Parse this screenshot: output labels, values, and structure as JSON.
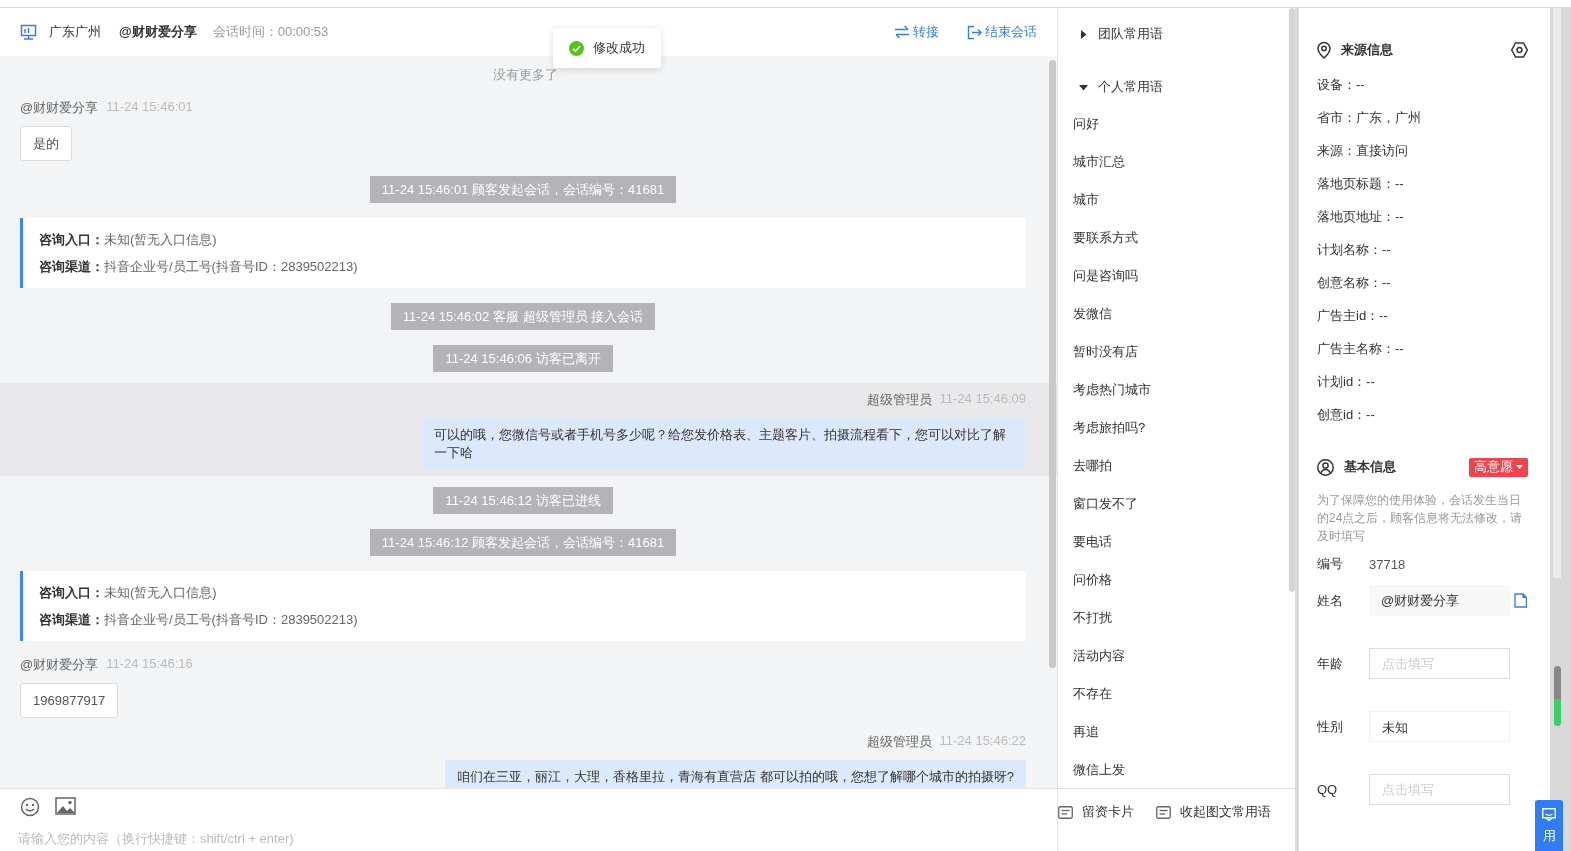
{
  "header": {
    "location": "广东广州",
    "visitor": "@财财爱分享",
    "duration_label": "会话时间：",
    "duration": "00:00:53",
    "actions": [
      {
        "kind": "transfer",
        "label": "转接"
      },
      {
        "kind": "end",
        "label": "结束会话"
      }
    ]
  },
  "toast": {
    "text": "修改成功"
  },
  "messages": [
    {
      "kind": "notice",
      "text": "没有更多了"
    },
    {
      "kind": "visitor",
      "name": "@财财爱分享",
      "time": "11-24 15:46:01",
      "text": "是的"
    },
    {
      "kind": "system",
      "text": "11-24 15:46:01 顾客发起会话，会话编号：41681"
    },
    {
      "kind": "info",
      "rows": [
        {
          "label": "咨询入口：",
          "value": "未知(暂无入口信息)"
        },
        {
          "label": "咨询渠道：",
          "value": "抖音企业号/员工号(抖音号ID：2839502213)"
        }
      ]
    },
    {
      "kind": "system",
      "text": "11-24 15:46:02 客服 超级管理员 接入会话"
    },
    {
      "kind": "system",
      "text": "11-24 15:46:06 访客已离开"
    },
    {
      "kind": "agent",
      "name": "超级管理员",
      "time": "11-24 15:46:09",
      "text": "可以的哦，您微信号或者手机号多少呢？给您发价格表、主题客片、拍摄流程看下，您可以对比了解一下哈",
      "highlighted": true
    },
    {
      "kind": "system",
      "text": "11-24 15:46:12 访客已进线"
    },
    {
      "kind": "system",
      "text": "11-24 15:46:12 顾客发起会话，会话编号：41681"
    },
    {
      "kind": "info",
      "rows": [
        {
          "label": "咨询入口：",
          "value": "未知(暂无入口信息)"
        },
        {
          "label": "咨询渠道：",
          "value": "抖音企业号/员工号(抖音号ID：2839502213)"
        }
      ]
    },
    {
      "kind": "visitor",
      "name": "@财财爱分享",
      "time": "11-24 15:46:16",
      "text": "1969877917"
    },
    {
      "kind": "agent",
      "name": "超级管理员",
      "time": "11-24 15:46:22",
      "text": "咱们在三亚，丽江，大理，香格里拉，青海有直营店 都可以拍的哦，您想了解哪个城市的拍摄呀?",
      "highlighted": false
    }
  ],
  "composer": {
    "placeholder": "请输入您的内容（换行快捷键：shift/ctrl + enter)"
  },
  "phrases": {
    "groups": [
      {
        "title": "团队常用语",
        "expanded": false
      },
      {
        "title": "个人常用语",
        "expanded": true,
        "items": [
          "问好",
          "城市汇总",
          "城市",
          "要联系方式",
          "问是咨询吗",
          "发微信",
          "暂时没有店",
          "考虑热门城市",
          "考虑旅拍吗?",
          "去哪拍",
          "窗口发不了",
          "要电话",
          "问价格",
          "不打扰",
          "活动内容",
          "不存在",
          "再追",
          "微信上发"
        ]
      }
    ],
    "footer": [
      "留资卡片",
      "收起图文常用语"
    ]
  },
  "source": {
    "title": "来源信息",
    "fields": [
      "设备：--",
      "省市：广东，广州",
      "来源：直接访问",
      "落地页标题：--",
      "落地页地址：--",
      "计划名称：--",
      "创意名称：--",
      "广告主id：--",
      "广告主名称：--",
      "计划id：--",
      "创意id：--"
    ]
  },
  "basic": {
    "title": "基本信息",
    "tag": "高意愿",
    "note": "为了保障您的使用体验，会话发生当日的24点之后，顾客信息将无法修改，请及时填写",
    "id_label": "编号",
    "id": "37718",
    "fields": [
      {
        "label": "姓名",
        "kind": "readonly",
        "value": "@财财爱分享",
        "copyable": true
      },
      {
        "label": "年龄",
        "kind": "input",
        "placeholder": "点击填写",
        "copyable": false
      },
      {
        "label": "性别",
        "kind": "select",
        "value": "未知",
        "copyable": false
      },
      {
        "label": "QQ",
        "kind": "input",
        "placeholder": "点击填写",
        "copyable": false
      }
    ]
  },
  "float_button": {
    "label": "用"
  }
}
